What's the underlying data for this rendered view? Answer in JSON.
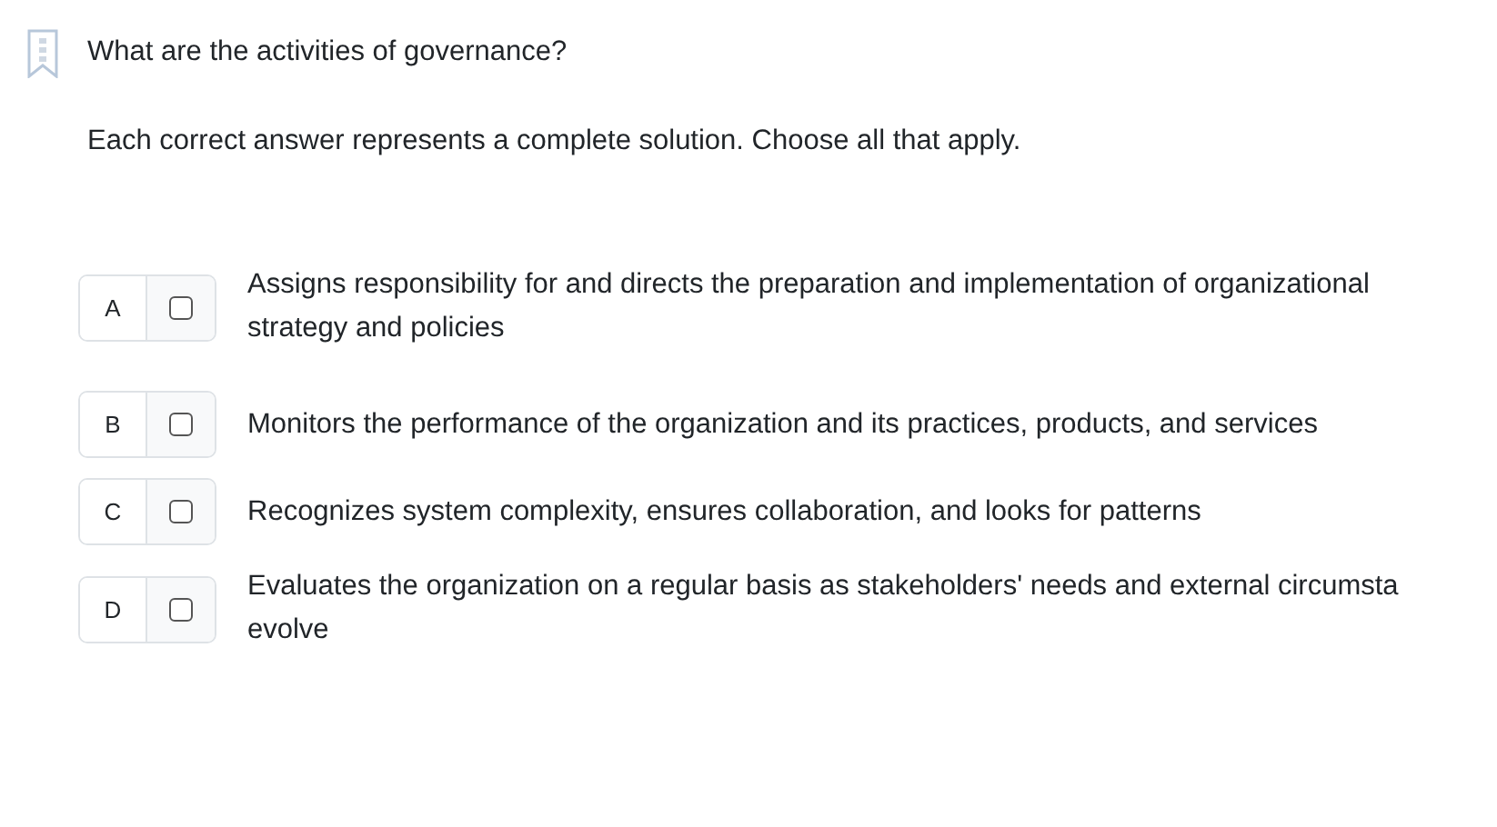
{
  "question": "What are the activities of governance?",
  "instruction": "Each correct answer represents a complete solution. Choose all that apply.",
  "options": [
    {
      "letter": "A",
      "checked": false,
      "lines": [
        "Assigns responsibility for and directs the preparation and implementation of organizational",
        "strategy and policies"
      ]
    },
    {
      "letter": "B",
      "checked": false,
      "lines": [
        "Monitors the performance of the organization and its practices, products, and services"
      ]
    },
    {
      "letter": "C",
      "checked": false,
      "lines": [
        "Recognizes system complexity, ensures collaboration, and looks for patterns"
      ]
    },
    {
      "letter": "D",
      "checked": false,
      "lines": [
        "Evaluates the organization on a regular basis as stakeholders' needs and external circumsta",
        "evolve"
      ]
    }
  ]
}
